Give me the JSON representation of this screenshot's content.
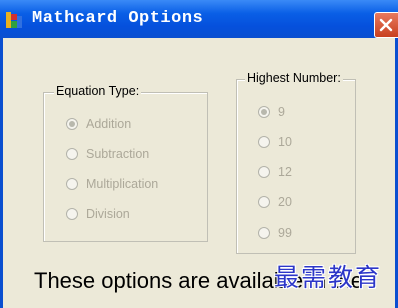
{
  "window": {
    "title": "Mathcard Options",
    "close_glyph": "✕"
  },
  "equation_type": {
    "label": "Equation Type:",
    "options": [
      {
        "label": "Addition",
        "checked": true
      },
      {
        "label": "Subtraction",
        "checked": false
      },
      {
        "label": "Multiplication",
        "checked": false
      },
      {
        "label": "Division",
        "checked": false
      }
    ]
  },
  "highest_number": {
    "label": "Highest Number:",
    "options": [
      {
        "label": "9",
        "checked": true
      },
      {
        "label": "10",
        "checked": false
      },
      {
        "label": "12",
        "checked": false
      },
      {
        "label": "20",
        "checked": false
      },
      {
        "label": "99",
        "checked": false
      }
    ]
  },
  "note": {
    "line1": "These options are available in the",
    "line2": ""
  },
  "watermark": "最需教育",
  "colors": {
    "titlebar": "#0550dc",
    "dialog_bg": "#ece9d8",
    "disabled_text": "#aca899",
    "watermark": "#2c36c8"
  }
}
